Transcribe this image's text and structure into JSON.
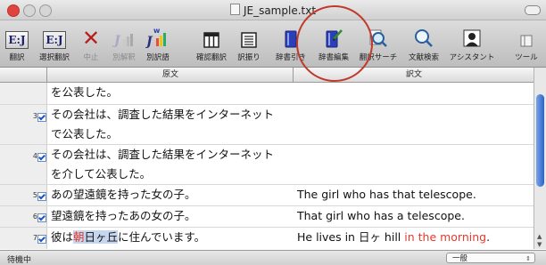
{
  "window": {
    "title": "JE_sample.txt"
  },
  "toolbar": {
    "buttons": [
      {
        "label": "翻訳",
        "icon": "ej-translate-icon",
        "enabled": true
      },
      {
        "label": "選択翻訳",
        "icon": "ej-selection-translate-icon",
        "enabled": true
      },
      {
        "label": "中止",
        "icon": "stop-x-icon",
        "enabled": false
      },
      {
        "label": "別解釈",
        "icon": "alternate-interpretation-icon",
        "enabled": false
      },
      {
        "label": "別訳語",
        "icon": "alternate-term-icon",
        "enabled": true
      },
      {
        "label": "確認翻訳",
        "icon": "confirm-translate-icon",
        "enabled": true
      },
      {
        "label": "訳振り",
        "icon": "interlinear-icon",
        "enabled": true
      },
      {
        "label": "辞書引き",
        "icon": "dictionary-lookup-icon",
        "enabled": true
      },
      {
        "label": "辞書編集",
        "icon": "dictionary-edit-icon",
        "enabled": true
      },
      {
        "label": "翻訳サーチ",
        "icon": "translation-search-icon",
        "enabled": true
      },
      {
        "label": "文献検索",
        "icon": "document-search-icon",
        "enabled": true
      },
      {
        "label": "アシスタント",
        "icon": "assistant-icon",
        "enabled": true
      },
      {
        "label": "ツール",
        "icon": "tools-icon",
        "enabled": true
      }
    ],
    "ej_text": "E:J"
  },
  "columns": {
    "source": "原文",
    "target": "訳文"
  },
  "rows": [
    {
      "num": "",
      "checked": false,
      "source_lines": [
        "を公表した。"
      ],
      "target": ""
    },
    {
      "num": "3",
      "checked": true,
      "source_lines": [
        "その会社は、調査した結果をインターネット",
        "で公表した。"
      ],
      "target": ""
    },
    {
      "num": "4",
      "checked": true,
      "source_lines": [
        "その会社は、調査した結果をインターネット",
        "を介して公表した。"
      ],
      "target": ""
    },
    {
      "num": "5",
      "checked": true,
      "source_lines": [
        "あの望遠鏡を持った女の子。"
      ],
      "target": "The girl who has that telescope."
    },
    {
      "num": "6",
      "checked": true,
      "source_lines": [
        "望遠鏡を持ったあの女の子。"
      ],
      "target": "That girl who has a telescope."
    },
    {
      "num": "7",
      "checked": true,
      "source_parts": [
        "彼は",
        "朝",
        "日ヶ丘",
        "に住んでいます。"
      ],
      "target_parts": [
        "He lives in 日ヶ hill ",
        "in the morning",
        "."
      ]
    }
  ],
  "status": {
    "text": "待機中",
    "mode": "一般"
  },
  "colors": {
    "accent_red": "#e53a2d",
    "highlight": "#c6d6f0",
    "annotation_circle": "#c0392b"
  }
}
